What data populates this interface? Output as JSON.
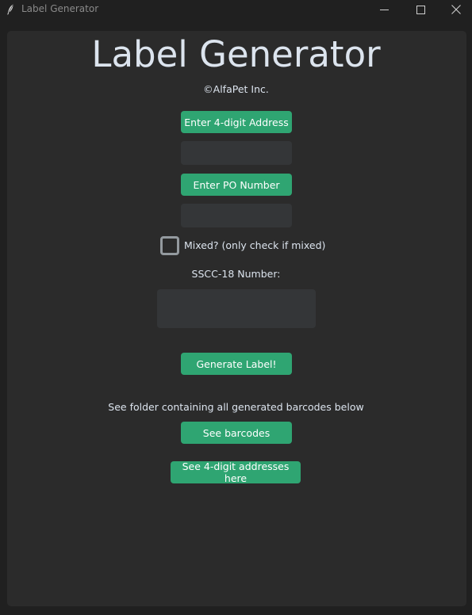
{
  "window": {
    "title": "Label Generator"
  },
  "app": {
    "title": "Label Generator",
    "copyright": "©AlfaPet Inc."
  },
  "form": {
    "address_button": "Enter 4-digit Address",
    "address_value": "",
    "po_button": "Enter PO Number",
    "po_value": "",
    "mixed_label": "Mixed? (only check if mixed)",
    "mixed_checked": false,
    "sscc_label": "SSCC-18 Number:",
    "sscc_value": "",
    "generate_button": "Generate Label!"
  },
  "links": {
    "folder_text": "See folder containing all generated barcodes below",
    "barcodes_button": "See barcodes",
    "addresses_button": "See 4-digit addresses here"
  },
  "colors": {
    "accent": "#2fa572",
    "background": "#2b2b2b",
    "entry_background": "#343638"
  },
  "icons": {
    "app": "feather-icon",
    "minimize": "minimize-icon",
    "maximize": "maximize-icon",
    "close": "close-icon"
  }
}
